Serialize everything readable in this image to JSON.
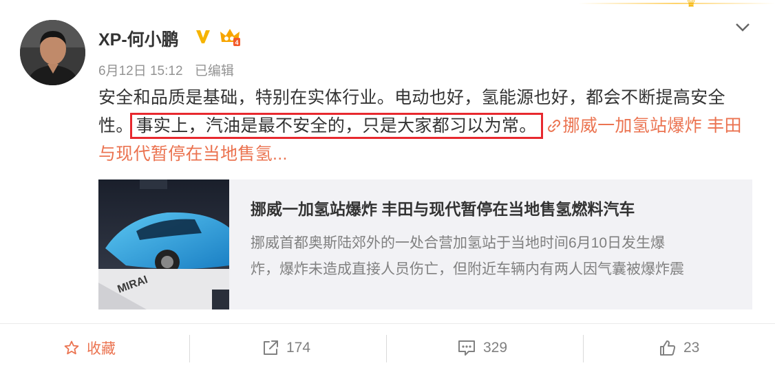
{
  "post": {
    "username": "XP-何小鹏",
    "date": "6月12日 15:12",
    "edited": "已编辑",
    "text_before": "安全和品质是基础，特别在实体行业。电动也好，氢能源也好，都会不断提高安全性。",
    "text_highlight": "事实上，汽油是最不安全的，只是大家都习以为常。",
    "link_text": "挪威一加氢站爆炸 丰田与现代暂停在当地售氢..."
  },
  "card": {
    "title": "挪威一加氢站爆炸 丰田与现代暂停在当地售氢燃料汽车",
    "desc_line1": "挪威首都奥斯陆郊外的一处合营加氢站于当地时间6月10日发生爆",
    "desc_line2": "炸，爆炸未造成直接人员伤亡，但附近车辆内有两人因气囊被爆炸震",
    "image_text": "MIRAI"
  },
  "actions": {
    "favorite": "收藏",
    "share_count": "174",
    "comment_count": "329",
    "like_count": "23"
  },
  "colors": {
    "accent": "#eb7350",
    "highlight_border": "#e7282e",
    "verified": "#f6b400"
  }
}
